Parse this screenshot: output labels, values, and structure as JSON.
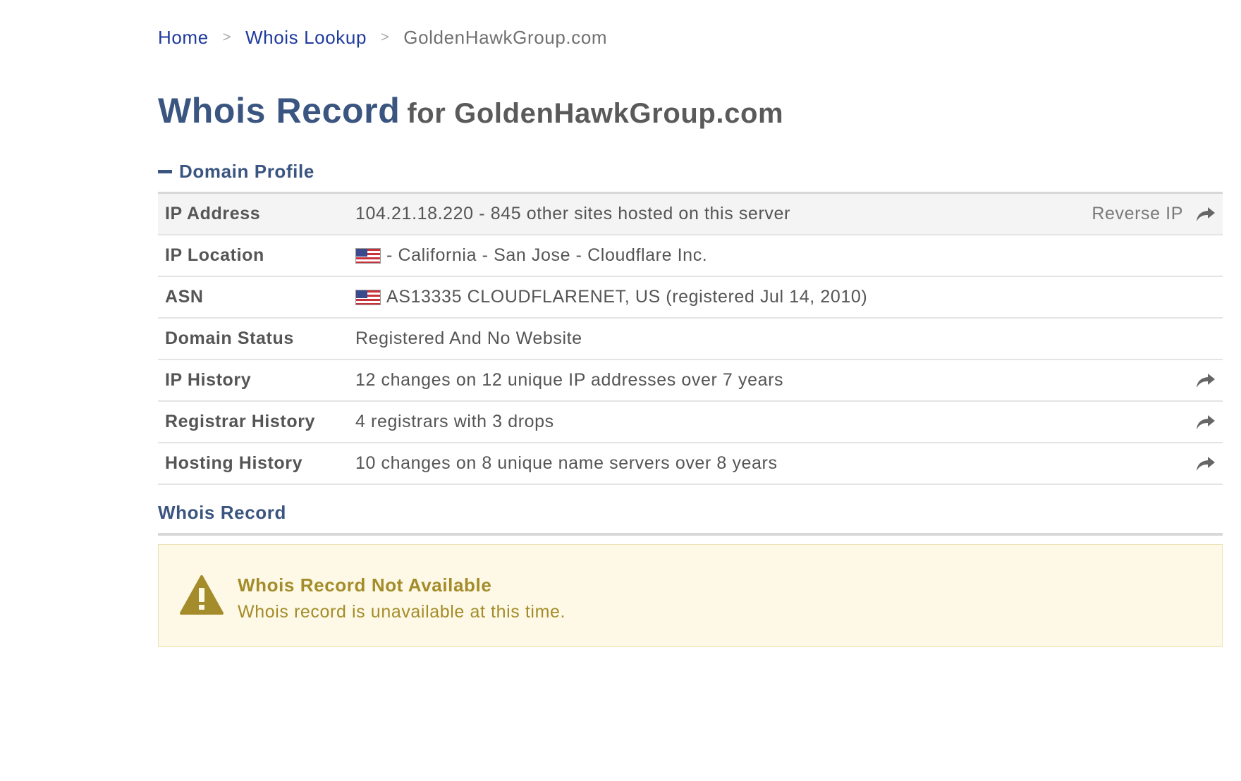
{
  "breadcrumb": {
    "home": "Home",
    "lookup": "Whois Lookup",
    "current": "GoldenHawkGroup.com",
    "separator": ">"
  },
  "title": {
    "main": "Whois Record",
    "sub": "for GoldenHawkGroup.com"
  },
  "profile": {
    "heading": "Domain Profile",
    "rows": [
      {
        "label": "IP Address",
        "value": "104.21.18.220 - 845 other sites hosted on this server",
        "action": "Reverse IP"
      },
      {
        "label": "IP Location",
        "value": "- California - San Jose - Cloudflare Inc."
      },
      {
        "label": "ASN",
        "value": "AS13335 CLOUDFLARENET, US (registered Jul 14, 2010)"
      },
      {
        "label": "Domain Status",
        "value": "Registered And No Website"
      },
      {
        "label": "IP History",
        "value": "12 changes on 12 unique IP addresses over 7 years"
      },
      {
        "label": "Registrar History",
        "value": "4 registrars with 3 drops"
      },
      {
        "label": "Hosting History",
        "value": "10 changes on 8 unique name servers over 8 years"
      }
    ]
  },
  "whois": {
    "heading": "Whois Record",
    "alert_title": "Whois Record Not Available",
    "alert_text": "Whois record is unavailable at this time."
  },
  "icons": {
    "flag": "us-flag-icon",
    "share": "share-arrow-icon",
    "warning": "warning-icon",
    "collapse": "minus-icon"
  },
  "colors": {
    "link": "#1f3a9e",
    "heading": "#3a5580",
    "alert_text": "#a48c2a",
    "alert_bg": "#fdf9e6"
  }
}
